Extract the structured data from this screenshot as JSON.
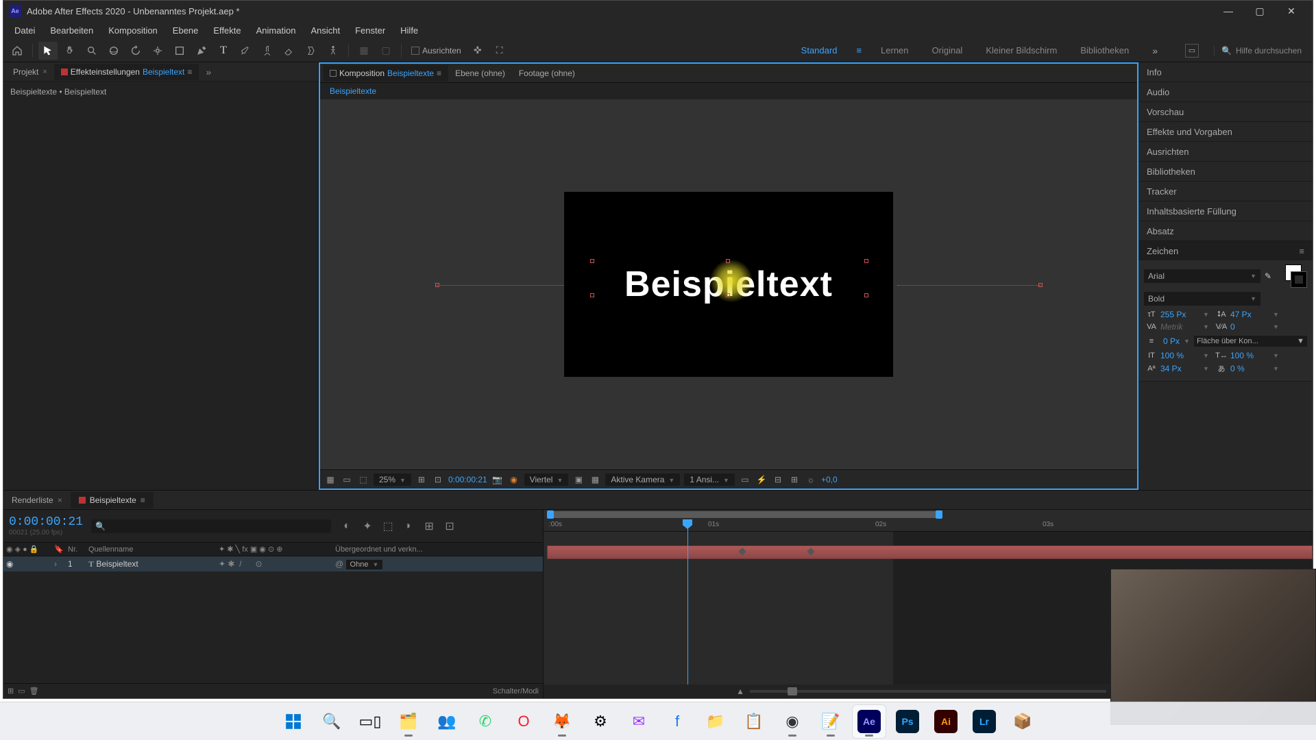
{
  "title": "Adobe After Effects 2020 - Unbenanntes Projekt.aep *",
  "menu": [
    "Datei",
    "Bearbeiten",
    "Komposition",
    "Ebene",
    "Effekte",
    "Animation",
    "Ansicht",
    "Fenster",
    "Hilfe"
  ],
  "toolbar": {
    "ausrichten": "Ausrichten"
  },
  "workspaces": {
    "items": [
      "Standard",
      "Lernen",
      "Original",
      "Kleiner Bildschirm",
      "Bibliotheken"
    ],
    "active": "Standard",
    "search_placeholder": "Hilfe durchsuchen"
  },
  "left_panel": {
    "tab_project": "Projekt",
    "tab_effect_prefix": "Effekteinstellungen",
    "tab_effect_name": "Beispieltext",
    "path": "Beispieltexte • Beispieltext"
  },
  "center_panel": {
    "tab_comp_prefix": "Komposition",
    "tab_comp_name": "Beispieltexte",
    "tab_layer": "Ebene (ohne)",
    "tab_footage": "Footage (ohne)",
    "crumb": "Beispieltexte",
    "text": "Beispieltext",
    "footer": {
      "zoom": "25%",
      "timecode": "0:00:00:21",
      "resolution": "Viertel",
      "camera": "Aktive Kamera",
      "views": "1 Ansi...",
      "exposure": "+0,0"
    }
  },
  "right_panel": {
    "sections": [
      "Info",
      "Audio",
      "Vorschau",
      "Effekte und Vorgaben",
      "Ausrichten",
      "Bibliotheken",
      "Tracker",
      "Inhaltsbasierte Füllung",
      "Absatz",
      "Zeichen"
    ],
    "char": {
      "font": "Arial",
      "weight": "Bold",
      "size": "255 Px",
      "leading": "47 Px",
      "kerning": "Metrik",
      "tracking": "0",
      "stroke": "0 Px",
      "stroke_mode": "Fläche über Kon...",
      "vscale": "100 %",
      "hscale": "100 %",
      "baseline": "34 Px",
      "tsume": "0 %"
    }
  },
  "timeline": {
    "tab_render": "Renderliste",
    "tab_comp": "Beispieltexte",
    "timecode": "0:00:00:21",
    "timecode_sub": "00021 (25.00 fps)",
    "cols": {
      "nr": "Nr.",
      "name": "Quellenname",
      "parent": "Übergeordnet und verkn..."
    },
    "layer": {
      "index": "1",
      "name": "Beispieltext",
      "parent": "Ohne"
    },
    "footer_mode": "Schalter/Modi",
    "ruler": {
      "t0": ":00s",
      "t1": "01s",
      "t2": "02s",
      "t3": "03s"
    }
  },
  "taskbar": {
    "apps": [
      "windows",
      "search",
      "taskview",
      "explorer-alt",
      "teams",
      "whatsapp",
      "opera",
      "firefox",
      "app1",
      "messenger",
      "facebook",
      "folder",
      "app2",
      "obs",
      "notepad",
      "ae",
      "ps",
      "ai",
      "lr",
      "app3"
    ]
  }
}
